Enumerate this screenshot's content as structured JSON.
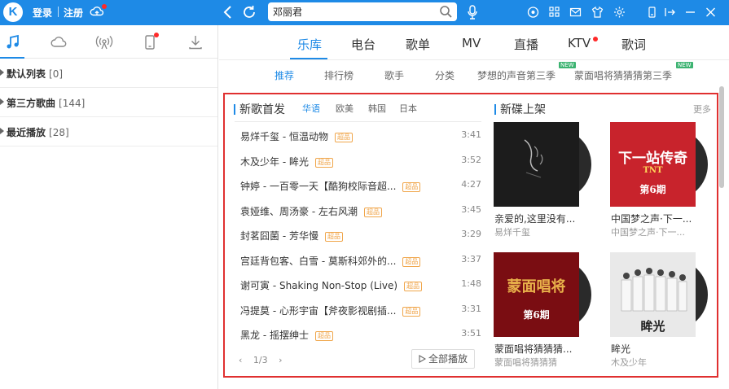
{
  "topbar": {
    "logo": "K",
    "login": "登录",
    "register": "注册",
    "search_value": "邓丽君"
  },
  "sidebar": {
    "playlists": [
      {
        "name": "默认列表",
        "count": "[0]"
      },
      {
        "name": "第三方歌曲",
        "count": "[144]"
      },
      {
        "name": "最近播放",
        "count": "[28]"
      }
    ]
  },
  "main_tabs": [
    "乐库",
    "电台",
    "歌单",
    "MV",
    "直播",
    "KTV",
    "歌词"
  ],
  "sub_tabs": [
    {
      "label": "推荐"
    },
    {
      "label": "排行榜"
    },
    {
      "label": "歌手"
    },
    {
      "label": "分类"
    },
    {
      "label": "梦想的声音第三季",
      "badge": "NEW"
    },
    {
      "label": "蒙面唱将猜猜猜第三季",
      "badge": "NEW"
    }
  ],
  "new_songs": {
    "title": "新歌首发",
    "tabs": [
      "华语",
      "欧美",
      "韩国",
      "日本"
    ],
    "hq_badge": "超品",
    "songs": [
      {
        "title": "易烊千玺 - 恒温动物",
        "duration": "3:41"
      },
      {
        "title": "木及少年 - 眸光",
        "duration": "3:52"
      },
      {
        "title": "钟婷 - 一百零一天【酷狗校际音超...",
        "duration": "4:27"
      },
      {
        "title": "袁娅维、周汤豪 - 左右风潮",
        "duration": "3:45"
      },
      {
        "title": "封茗囧菌 - 芳华慢",
        "duration": "3:29"
      },
      {
        "title": "宫廷背包客、白雪 - 莫斯科郊外的...",
        "duration": "3:37"
      },
      {
        "title": "谢可寅 - Shaking Non-Stop (Live)",
        "duration": "1:48"
      },
      {
        "title": "冯提莫 - 心形宇宙【斧夜影视剧插...",
        "duration": "3:31"
      },
      {
        "title": "黑龙 - 摇摆绅士",
        "duration": "3:51"
      }
    ],
    "pager": {
      "prev": "‹",
      "page": "1/3",
      "next": "›"
    },
    "play_all": "全部播放"
  },
  "new_albums": {
    "title": "新碟上架",
    "more": "更多",
    "albums": [
      {
        "name": "亲爱的,这里没有...",
        "artist": "易烊千玺",
        "cover_color": "#1c1c1c"
      },
      {
        "name": "中国梦之声·下一...",
        "artist": "中国梦之声·下一...",
        "cover_color": "#c8232c",
        "cover_text": "下一站传奇",
        "cover_sub": "TNT",
        "cover_ep": "第6期"
      },
      {
        "name": "蒙面唱将猜猜猜...",
        "artist": "蒙面唱将猜猜猜",
        "cover_color": "#7a0d12",
        "cover_text": "蒙面唱将",
        "cover_ep": "第6期"
      },
      {
        "name": "眸光",
        "artist": "木及少年",
        "cover_color": "#e9e9e9",
        "cover_text": "眸光"
      }
    ]
  },
  "colors": {
    "accent": "#1e8ae6",
    "frame": "#e03030",
    "hq": "#f0a64b"
  }
}
